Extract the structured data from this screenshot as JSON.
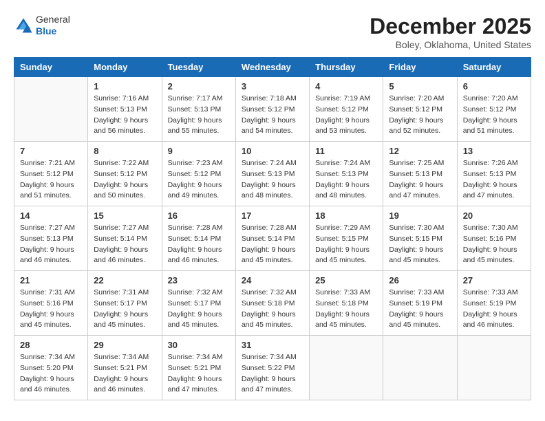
{
  "logo": {
    "general": "General",
    "blue": "Blue"
  },
  "title": "December 2025",
  "subtitle": "Boley, Oklahoma, United States",
  "weekdays": [
    "Sunday",
    "Monday",
    "Tuesday",
    "Wednesday",
    "Thursday",
    "Friday",
    "Saturday"
  ],
  "weeks": [
    [
      {
        "day": "",
        "sunrise": "",
        "sunset": "",
        "daylight": ""
      },
      {
        "day": "1",
        "sunrise": "Sunrise: 7:16 AM",
        "sunset": "Sunset: 5:13 PM",
        "daylight": "Daylight: 9 hours and 56 minutes."
      },
      {
        "day": "2",
        "sunrise": "Sunrise: 7:17 AM",
        "sunset": "Sunset: 5:13 PM",
        "daylight": "Daylight: 9 hours and 55 minutes."
      },
      {
        "day": "3",
        "sunrise": "Sunrise: 7:18 AM",
        "sunset": "Sunset: 5:12 PM",
        "daylight": "Daylight: 9 hours and 54 minutes."
      },
      {
        "day": "4",
        "sunrise": "Sunrise: 7:19 AM",
        "sunset": "Sunset: 5:12 PM",
        "daylight": "Daylight: 9 hours and 53 minutes."
      },
      {
        "day": "5",
        "sunrise": "Sunrise: 7:20 AM",
        "sunset": "Sunset: 5:12 PM",
        "daylight": "Daylight: 9 hours and 52 minutes."
      },
      {
        "day": "6",
        "sunrise": "Sunrise: 7:20 AM",
        "sunset": "Sunset: 5:12 PM",
        "daylight": "Daylight: 9 hours and 51 minutes."
      }
    ],
    [
      {
        "day": "7",
        "sunrise": "Sunrise: 7:21 AM",
        "sunset": "Sunset: 5:12 PM",
        "daylight": "Daylight: 9 hours and 51 minutes."
      },
      {
        "day": "8",
        "sunrise": "Sunrise: 7:22 AM",
        "sunset": "Sunset: 5:12 PM",
        "daylight": "Daylight: 9 hours and 50 minutes."
      },
      {
        "day": "9",
        "sunrise": "Sunrise: 7:23 AM",
        "sunset": "Sunset: 5:12 PM",
        "daylight": "Daylight: 9 hours and 49 minutes."
      },
      {
        "day": "10",
        "sunrise": "Sunrise: 7:24 AM",
        "sunset": "Sunset: 5:13 PM",
        "daylight": "Daylight: 9 hours and 48 minutes."
      },
      {
        "day": "11",
        "sunrise": "Sunrise: 7:24 AM",
        "sunset": "Sunset: 5:13 PM",
        "daylight": "Daylight: 9 hours and 48 minutes."
      },
      {
        "day": "12",
        "sunrise": "Sunrise: 7:25 AM",
        "sunset": "Sunset: 5:13 PM",
        "daylight": "Daylight: 9 hours and 47 minutes."
      },
      {
        "day": "13",
        "sunrise": "Sunrise: 7:26 AM",
        "sunset": "Sunset: 5:13 PM",
        "daylight": "Daylight: 9 hours and 47 minutes."
      }
    ],
    [
      {
        "day": "14",
        "sunrise": "Sunrise: 7:27 AM",
        "sunset": "Sunset: 5:13 PM",
        "daylight": "Daylight: 9 hours and 46 minutes."
      },
      {
        "day": "15",
        "sunrise": "Sunrise: 7:27 AM",
        "sunset": "Sunset: 5:14 PM",
        "daylight": "Daylight: 9 hours and 46 minutes."
      },
      {
        "day": "16",
        "sunrise": "Sunrise: 7:28 AM",
        "sunset": "Sunset: 5:14 PM",
        "daylight": "Daylight: 9 hours and 46 minutes."
      },
      {
        "day": "17",
        "sunrise": "Sunrise: 7:28 AM",
        "sunset": "Sunset: 5:14 PM",
        "daylight": "Daylight: 9 hours and 45 minutes."
      },
      {
        "day": "18",
        "sunrise": "Sunrise: 7:29 AM",
        "sunset": "Sunset: 5:15 PM",
        "daylight": "Daylight: 9 hours and 45 minutes."
      },
      {
        "day": "19",
        "sunrise": "Sunrise: 7:30 AM",
        "sunset": "Sunset: 5:15 PM",
        "daylight": "Daylight: 9 hours and 45 minutes."
      },
      {
        "day": "20",
        "sunrise": "Sunrise: 7:30 AM",
        "sunset": "Sunset: 5:16 PM",
        "daylight": "Daylight: 9 hours and 45 minutes."
      }
    ],
    [
      {
        "day": "21",
        "sunrise": "Sunrise: 7:31 AM",
        "sunset": "Sunset: 5:16 PM",
        "daylight": "Daylight: 9 hours and 45 minutes."
      },
      {
        "day": "22",
        "sunrise": "Sunrise: 7:31 AM",
        "sunset": "Sunset: 5:17 PM",
        "daylight": "Daylight: 9 hours and 45 minutes."
      },
      {
        "day": "23",
        "sunrise": "Sunrise: 7:32 AM",
        "sunset": "Sunset: 5:17 PM",
        "daylight": "Daylight: 9 hours and 45 minutes."
      },
      {
        "day": "24",
        "sunrise": "Sunrise: 7:32 AM",
        "sunset": "Sunset: 5:18 PM",
        "daylight": "Daylight: 9 hours and 45 minutes."
      },
      {
        "day": "25",
        "sunrise": "Sunrise: 7:33 AM",
        "sunset": "Sunset: 5:18 PM",
        "daylight": "Daylight: 9 hours and 45 minutes."
      },
      {
        "day": "26",
        "sunrise": "Sunrise: 7:33 AM",
        "sunset": "Sunset: 5:19 PM",
        "daylight": "Daylight: 9 hours and 45 minutes."
      },
      {
        "day": "27",
        "sunrise": "Sunrise: 7:33 AM",
        "sunset": "Sunset: 5:19 PM",
        "daylight": "Daylight: 9 hours and 46 minutes."
      }
    ],
    [
      {
        "day": "28",
        "sunrise": "Sunrise: 7:34 AM",
        "sunset": "Sunset: 5:20 PM",
        "daylight": "Daylight: 9 hours and 46 minutes."
      },
      {
        "day": "29",
        "sunrise": "Sunrise: 7:34 AM",
        "sunset": "Sunset: 5:21 PM",
        "daylight": "Daylight: 9 hours and 46 minutes."
      },
      {
        "day": "30",
        "sunrise": "Sunrise: 7:34 AM",
        "sunset": "Sunset: 5:21 PM",
        "daylight": "Daylight: 9 hours and 47 minutes."
      },
      {
        "day": "31",
        "sunrise": "Sunrise: 7:34 AM",
        "sunset": "Sunset: 5:22 PM",
        "daylight": "Daylight: 9 hours and 47 minutes."
      },
      {
        "day": "",
        "sunrise": "",
        "sunset": "",
        "daylight": ""
      },
      {
        "day": "",
        "sunrise": "",
        "sunset": "",
        "daylight": ""
      },
      {
        "day": "",
        "sunrise": "",
        "sunset": "",
        "daylight": ""
      }
    ]
  ]
}
